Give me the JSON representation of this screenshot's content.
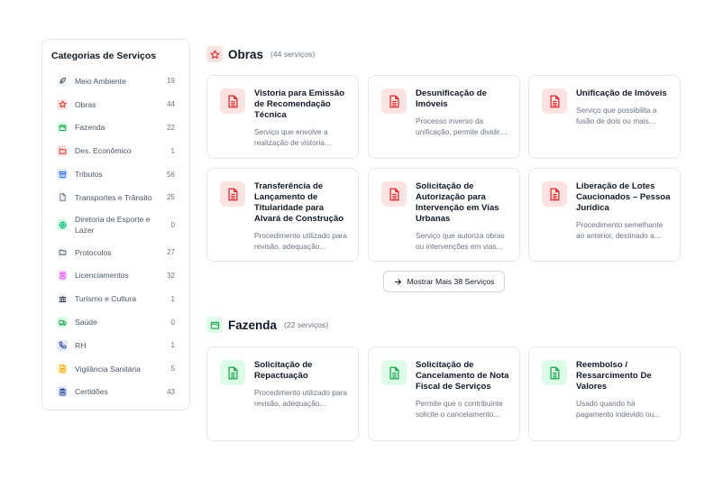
{
  "sidebar": {
    "title": "Categorias de Serviços",
    "items": [
      {
        "label": "Meio Ambiente",
        "count": "19",
        "icon": "leaf-icon",
        "color": "#4b5563"
      },
      {
        "label": "Obras",
        "count": "44",
        "icon": "star-icon",
        "color": "#dc2626"
      },
      {
        "label": "Fazenda",
        "count": "22",
        "icon": "wallet-icon",
        "color": "#16a34a"
      },
      {
        "label": "Des. Econômico",
        "count": "1",
        "icon": "folder-icon",
        "color": "#dc2626"
      },
      {
        "label": "Tributos",
        "count": "56",
        "icon": "archive-icon",
        "color": "#2563eb"
      },
      {
        "label": "Transportes e Trânsito",
        "count": "25",
        "icon": "file-icon",
        "color": "#6b7280"
      },
      {
        "label": "Diretoria de Esporte e Lazer",
        "count": "0",
        "icon": "globe-icon",
        "color": "#10b981"
      },
      {
        "label": "Protocolos",
        "count": "27",
        "icon": "folder-icon",
        "color": "#4b5563"
      },
      {
        "label": "Licenciamentos",
        "count": "32",
        "icon": "building-icon",
        "color": "#d946ef"
      },
      {
        "label": "Turismo e Cultura",
        "count": "1",
        "icon": "landmark-icon",
        "color": "#374151"
      },
      {
        "label": "Saúde",
        "count": "0",
        "icon": "truck-icon",
        "color": "#16a34a"
      },
      {
        "label": "RH",
        "count": "1",
        "icon": "phone-icon",
        "color": "#1e3a8a"
      },
      {
        "label": "Vigilância Sanitária",
        "count": "5",
        "icon": "document-icon",
        "color": "#f59e0b"
      },
      {
        "label": "Certidões",
        "count": "43",
        "icon": "clipboard-icon",
        "color": "#1e3a8a"
      }
    ]
  },
  "obras": {
    "title": "Obras",
    "count": "(44 serviços)",
    "cards": [
      {
        "title": "Vistoria para Emissão de Recomendação Técnica",
        "desc": "Serviço que envolve a realização de vistoria técnica..."
      },
      {
        "title": "Desunificação de Imóveis",
        "desc": "Processo inverso da unificação, permite dividir um imóvel..."
      },
      {
        "title": "Unificação de Imóveis",
        "desc": "Serviço que possibilita a fusão de dois ou mais imóveis..."
      },
      {
        "title": "Transferência de Lançamento de Titularidade para Alvará de Construção",
        "desc": "Procedimento utilizado para revisão, adequação..."
      },
      {
        "title": "Solicitação de Autorização para Intervenção em Vias Urbanas",
        "desc": "Serviço que autoriza obras ou intervenções em vias..."
      },
      {
        "title": "Liberação de Lotes Caucionados – Pessoa Jurídica",
        "desc": "Procedimento semelhante ao anterior, destinado a..."
      }
    ],
    "more_label": "Mostrar Mais 38 Serviços"
  },
  "fazenda": {
    "title": "Fazenda",
    "count": "(22 serviços)",
    "cards": [
      {
        "title": "Solicitação de Repactuação",
        "desc": "Procedimento utilizado para revisão, adequação..."
      },
      {
        "title": "Solicitação de Cancelamento de Nota Fiscal de Serviços",
        "desc": "Permite que o contribuinte solicite o cancelamento..."
      },
      {
        "title": "Reembolso / Ressarcimento De Valores",
        "desc": "Usado quando há pagamento indevido ou..."
      }
    ]
  },
  "colors": {
    "red": "#dc2626",
    "red_bg": "#fde2e2",
    "green": "#16a34a",
    "green_bg": "#dcfce7"
  }
}
